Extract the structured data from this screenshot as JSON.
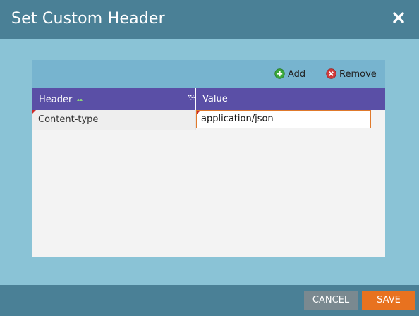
{
  "dialog": {
    "title": "Set Custom Header"
  },
  "toolbar": {
    "add_label": "Add",
    "remove_label": "Remove"
  },
  "grid": {
    "columns": [
      "Header",
      "Value"
    ],
    "rows": [
      {
        "header": "Content-type",
        "value": "application/json"
      }
    ]
  },
  "footer": {
    "cancel_label": "CANCEL",
    "save_label": "SAVE"
  },
  "colors": {
    "titlebar": "#4a8096",
    "grid_header": "#5a4fa6",
    "save": "#e8721f",
    "cancel": "#7a8990"
  },
  "icons": {
    "close": "close-icon",
    "add": "add-icon",
    "remove": "remove-icon",
    "sort": "sort-icon",
    "column_menu": "column-menu-icon"
  }
}
